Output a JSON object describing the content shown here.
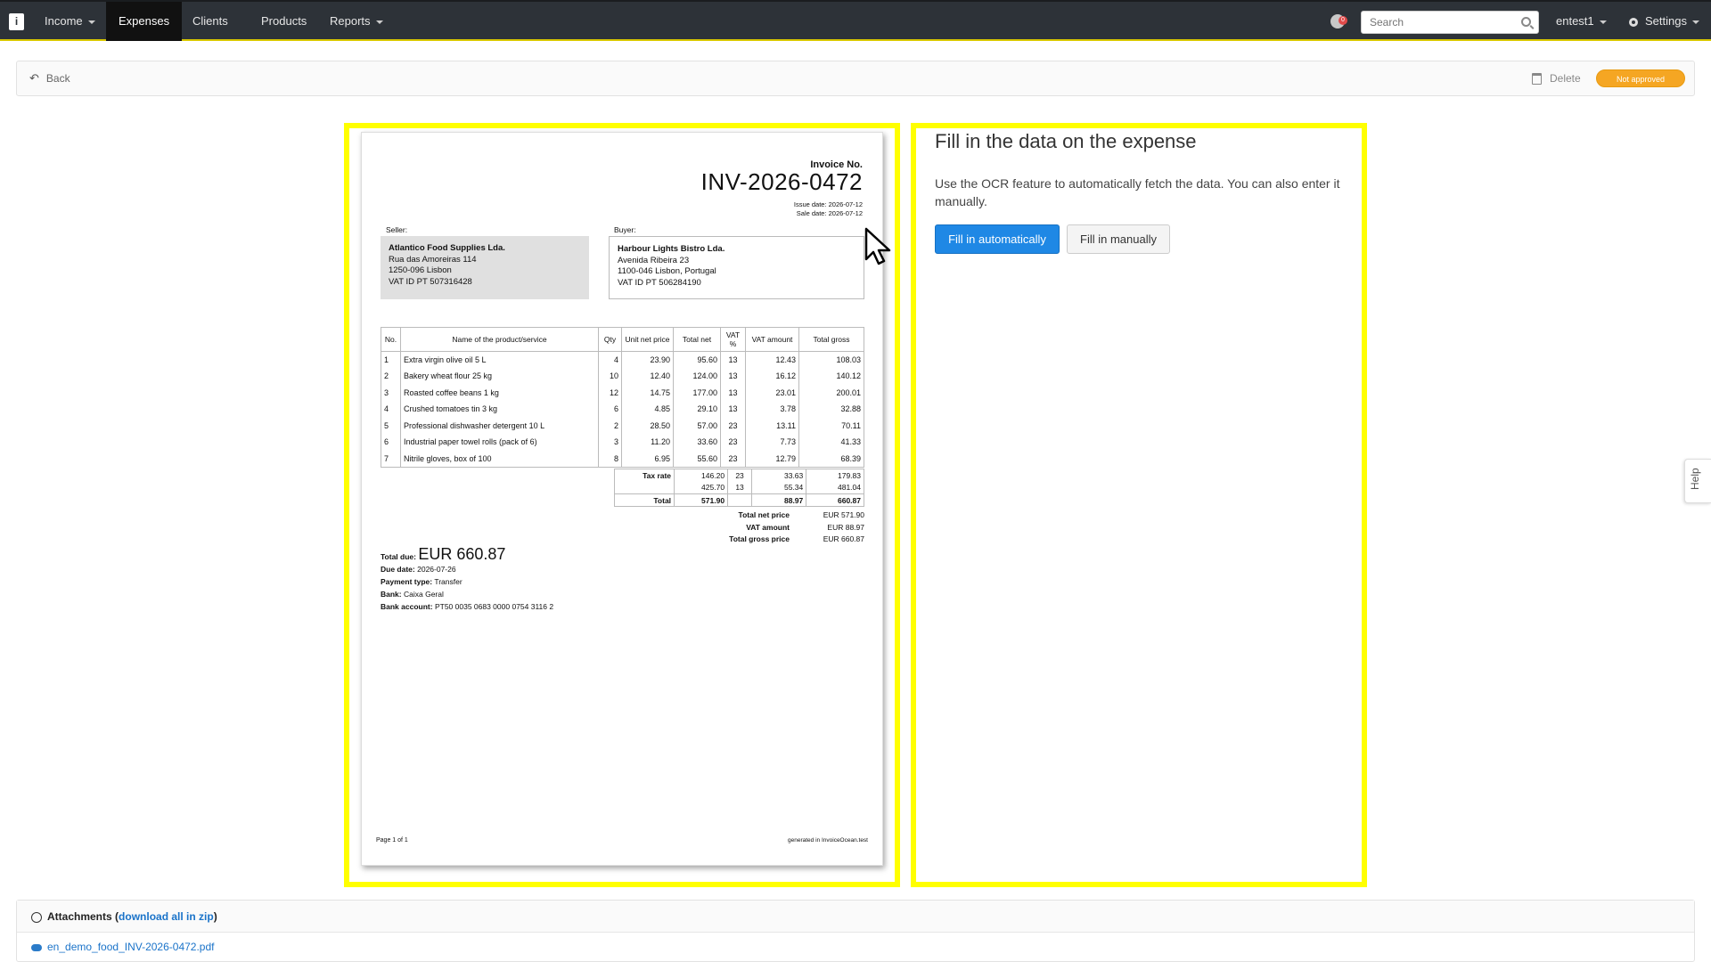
{
  "nav": {
    "logo": "i",
    "items": [
      {
        "label": "Income",
        "caret": true
      },
      {
        "label": "Expenses",
        "caret": false
      },
      {
        "label": "Clients",
        "caret": false
      },
      {
        "label": "Products",
        "caret": false
      },
      {
        "label": "Reports",
        "caret": true
      }
    ],
    "notification_count": "0",
    "search_placeholder": "Search",
    "user": "entest1",
    "settings": "Settings"
  },
  "toolbar": {
    "back": "Back",
    "delete": "Delete",
    "status_badge": "Not approved",
    "badge_color": "#f5a623"
  },
  "invoice": {
    "label": "Invoice No.",
    "number": "INV-2026-0472",
    "issue_date": "Issue date: 2026-07-12",
    "sale_date": "Sale date: 2026-07-12",
    "seller_label": "Seller:",
    "buyer_label": "Buyer:",
    "seller": {
      "name": "Atlantico Food Supplies Lda.",
      "line1": "Rua das Amoreiras 114",
      "line2": "1250-096 Lisbon",
      "vat": "VAT ID PT 507316428"
    },
    "buyer": {
      "name": "Harbour Lights Bistro Lda.",
      "line1": "Avenida Ribeira 23",
      "line2": "1100-046 Lisbon, Portugal",
      "vat": "VAT ID PT 506284190"
    },
    "columns": [
      "No.",
      "Name of the product/service",
      "Qty",
      "Unit net price",
      "Total net",
      "VAT %",
      "VAT amount",
      "Total gross"
    ],
    "rows": [
      [
        "1",
        "Extra virgin olive oil 5 L",
        "4",
        "23.90",
        "95.60",
        "13",
        "12.43",
        "108.03"
      ],
      [
        "2",
        "Bakery wheat flour 25 kg",
        "10",
        "12.40",
        "124.00",
        "13",
        "16.12",
        "140.12"
      ],
      [
        "3",
        "Roasted coffee beans 1 kg",
        "12",
        "14.75",
        "177.00",
        "13",
        "23.01",
        "200.01"
      ],
      [
        "4",
        "Crushed tomatoes tin 3 kg",
        "6",
        "4.85",
        "29.10",
        "13",
        "3.78",
        "32.88"
      ],
      [
        "5",
        "Professional dishwasher detergent 10 L",
        "2",
        "28.50",
        "57.00",
        "23",
        "13.11",
        "70.11"
      ],
      [
        "6",
        "Industrial paper towel rolls (pack of 6)",
        "3",
        "11.20",
        "33.60",
        "23",
        "7.73",
        "41.33"
      ],
      [
        "7",
        "Nitrile gloves, box of 100",
        "8",
        "6.95",
        "55.60",
        "23",
        "12.79",
        "68.39"
      ]
    ],
    "tax_rows": [
      [
        "Tax rate",
        "146.20",
        "23",
        "33.63",
        "179.83"
      ],
      [
        "",
        "425.70",
        "13",
        "55.34",
        "481.04"
      ],
      [
        "Total",
        "571.90",
        "",
        "88.97",
        "660.87"
      ]
    ],
    "summary": {
      "net_label": "Total net price",
      "net": "EUR 571.90",
      "vat_label": "VAT amount",
      "vat": "EUR 88.97",
      "gross_label": "Total gross price",
      "gross": "EUR 660.87"
    },
    "due": {
      "total_label": "Total due:",
      "total": "EUR 660.87",
      "date_label": "Due date:",
      "date": "2026-07-26",
      "payment_label": "Payment type:",
      "payment": "Transfer",
      "bank_label": "Bank:",
      "bank": "Caixa Geral",
      "account_label": "Bank account:",
      "account": "PT50 0035 0683 0000 0754 3116 2"
    },
    "page": "Page 1 of 1",
    "generated": "generated in InvoiceOcean.test"
  },
  "panel": {
    "title": "Fill in the data on the expense",
    "text": "Use the OCR feature to automatically fetch the data. You can also enter it manually.",
    "btn_auto": "Fill in automatically",
    "btn_manual": "Fill in manually",
    "primary_color": "#1f88e5",
    "highlight_color": "#ffff00"
  },
  "help": "Help",
  "attachments": {
    "title": "Attachments",
    "download_all": "download all in zip",
    "files": [
      "en_demo_food_INV-2026-0472.pdf"
    ]
  }
}
